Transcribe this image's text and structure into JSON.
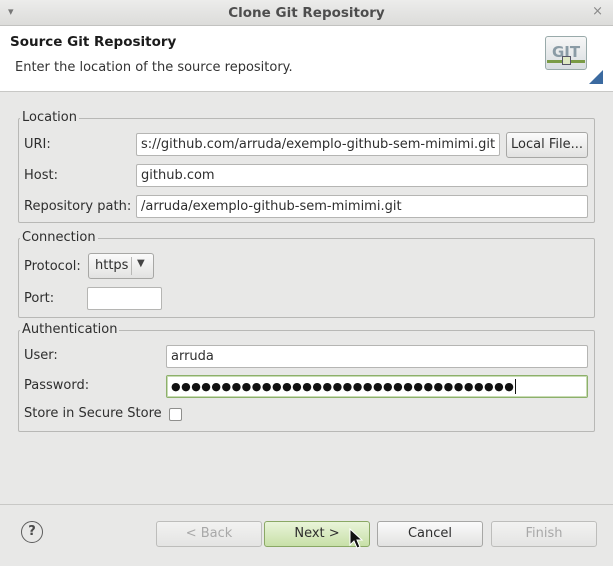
{
  "window": {
    "title": "Clone Git Repository",
    "menu_glyph": "▾",
    "close_glyph": "×"
  },
  "banner": {
    "title": "Source Git Repository",
    "description": "Enter the location of the source repository.",
    "logo_text": "GIT"
  },
  "location": {
    "legend": "Location",
    "uri_label": "URI:",
    "uri_value": "s://github.com/arruda/exemplo-github-sem-mimimi.git",
    "local_file_button": "Local File...",
    "host_label": "Host:",
    "host_value": "github.com",
    "repo_path_label": "Repository path:",
    "repo_path_value": "/arruda/exemplo-github-sem-mimimi.git"
  },
  "connection": {
    "legend": "Connection",
    "protocol_label": "Protocol:",
    "protocol_value": "https",
    "port_label": "Port:",
    "port_value": ""
  },
  "authentication": {
    "legend": "Authentication",
    "user_label": "User:",
    "user_value": "arruda",
    "password_label": "Password:",
    "password_dots": "●●●●●●●●●●●●●●●●●●●●●●●●●●●●●●●●●●",
    "store_label": "Store in Secure Store",
    "store_checked": false
  },
  "footer": {
    "help_glyph": "?",
    "back_button": "< Back",
    "next_button": "Next >",
    "cancel_button": "Cancel",
    "finish_button": "Finish"
  }
}
